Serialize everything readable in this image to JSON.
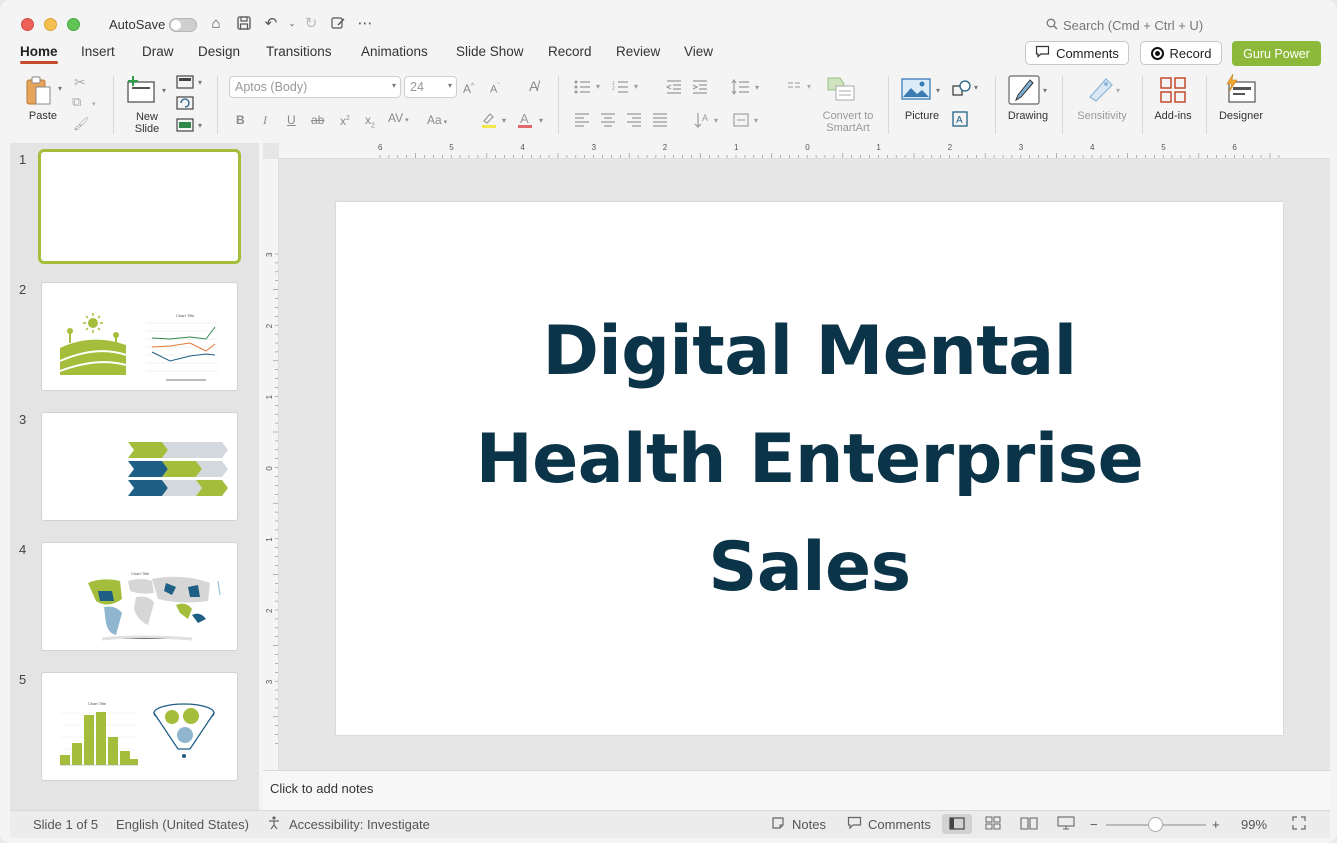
{
  "titlebar": {
    "autosave_label": "AutoSave",
    "search_placeholder": "Search (Cmd + Ctrl + U)"
  },
  "tabs": [
    {
      "label": "Home",
      "active": true
    },
    {
      "label": "Insert"
    },
    {
      "label": "Draw"
    },
    {
      "label": "Design"
    },
    {
      "label": "Transitions"
    },
    {
      "label": "Animations"
    },
    {
      "label": "Slide Show"
    },
    {
      "label": "Record"
    },
    {
      "label": "Review"
    },
    {
      "label": "View"
    }
  ],
  "header_buttons": {
    "comments": "Comments",
    "record": "Record",
    "guru": "Guru Power"
  },
  "ribbon": {
    "paste": "Paste",
    "new_slide_line1": "New",
    "new_slide_line2": "Slide",
    "font_name": "Aptos (Body)",
    "font_size": "24",
    "convert_line1": "Convert to",
    "convert_line2": "SmartArt",
    "picture": "Picture",
    "drawing": "Drawing",
    "sensitivity": "Sensitivity",
    "addins": "Add-ins",
    "designer": "Designer"
  },
  "thumbnails": [
    {
      "number": "1"
    },
    {
      "number": "2",
      "chart_title": "Chart Title"
    },
    {
      "number": "3"
    },
    {
      "number": "4",
      "chart_title": "Chart Title"
    },
    {
      "number": "5",
      "chart_title": "Chart Title"
    }
  ],
  "ruler": {
    "h_labels": [
      "6",
      "5",
      "4",
      "3",
      "2",
      "1",
      "0",
      "1",
      "2",
      "3",
      "4",
      "5",
      "6"
    ],
    "v_labels": [
      "3",
      "2",
      "1",
      "0",
      "1",
      "2",
      "3"
    ]
  },
  "slide": {
    "title": "Digital Mental Health Enterprise Sales",
    "title_color": "#0c3449"
  },
  "notes": {
    "placeholder": "Click to add notes"
  },
  "status": {
    "slide_count": "Slide 1 of 5",
    "language": "English (United States)",
    "accessibility": "Accessibility: Investigate",
    "notes": "Notes",
    "comments": "Comments",
    "zoom": "99%"
  },
  "colors": {
    "accent_green": "#a4bd3a",
    "brand_red": "#c34a2c",
    "navy": "#0c3449",
    "teal": "#1f5f85"
  }
}
